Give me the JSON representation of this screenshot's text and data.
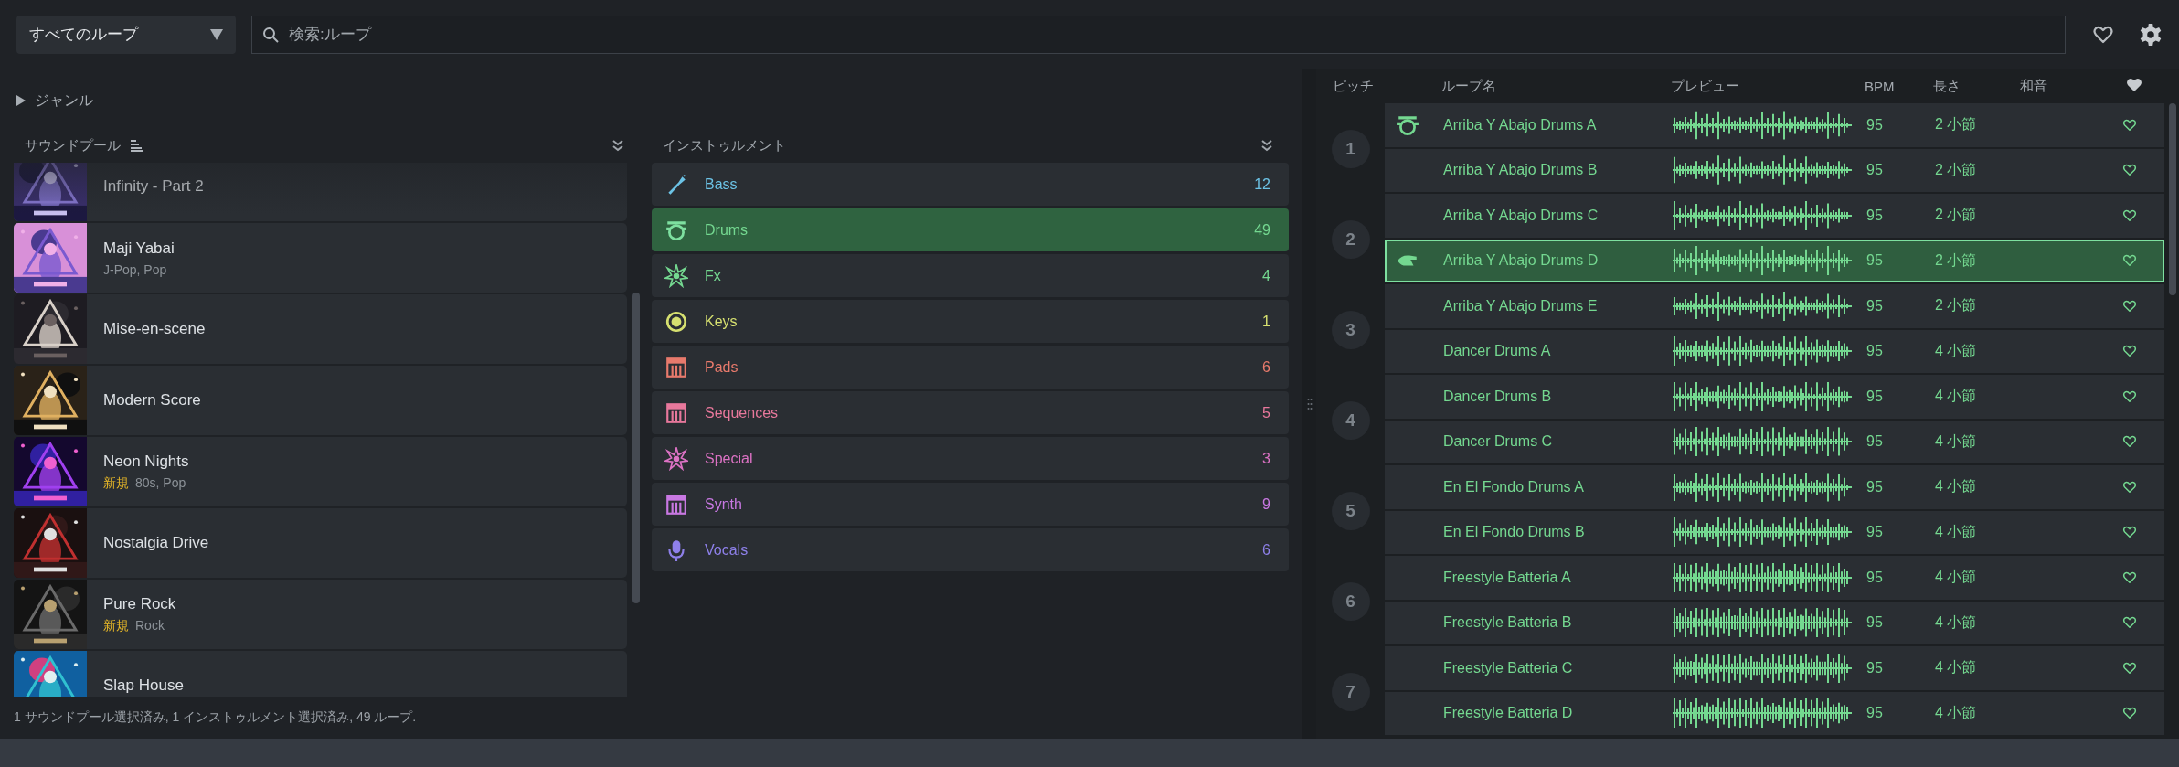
{
  "toolbar": {
    "loop_filter": "すべてのループ",
    "search": {
      "placeholder": "検索:ループ"
    }
  },
  "genre": {
    "label": "ジャンル",
    "expanded": false
  },
  "sound_pools": {
    "title": "サウンドプール",
    "items": [
      {
        "name": "Infinity - Part 2"
      },
      {
        "name": "Maji Yabai",
        "tags": "J-Pop, Pop"
      },
      {
        "name": "Mise-en-scene"
      },
      {
        "name": "Modern Score"
      },
      {
        "name": "Neon Nights",
        "badge": "新規",
        "tags": "80s, Pop"
      },
      {
        "name": "Nostalgia Drive"
      },
      {
        "name": "Pure Rock",
        "badge": "新規",
        "tags": "Rock"
      },
      {
        "name": "Slap House"
      }
    ]
  },
  "instruments": {
    "title": "インストゥルメント",
    "items": [
      {
        "name": "Bass",
        "count": "12",
        "color": "#6cc3e6",
        "kind": "bass",
        "selected": false
      },
      {
        "name": "Drums",
        "count": "49",
        "color": "#74d890",
        "kind": "drum",
        "selected": true
      },
      {
        "name": "Fx",
        "count": "4",
        "color": "#74d890",
        "kind": "burst",
        "selected": false
      },
      {
        "name": "Keys",
        "count": "1",
        "color": "#d6e070",
        "kind": "knob",
        "selected": false
      },
      {
        "name": "Pads",
        "count": "6",
        "color": "#e87a6c",
        "kind": "keyboard",
        "selected": false
      },
      {
        "name": "Sequences",
        "count": "5",
        "color": "#e8789c",
        "kind": "keyboard",
        "selected": false
      },
      {
        "name": "Special",
        "count": "3",
        "color": "#dc72c4",
        "kind": "burst",
        "selected": false
      },
      {
        "name": "Synth",
        "count": "9",
        "color": "#c878e2",
        "kind": "keyboard",
        "selected": false
      },
      {
        "name": "Vocals",
        "count": "6",
        "color": "#8e80ea",
        "kind": "mic",
        "selected": false
      }
    ]
  },
  "status": "1 サウンドプール選択済み, 1 インストゥルメント選択済み, 49 ループ.",
  "loops": {
    "columns": [
      "ピッチ",
      "ループ名",
      "プレビュー",
      "BPM",
      "長さ",
      "和音"
    ],
    "pitches": [
      "1",
      "2",
      "3",
      "4",
      "5",
      "6",
      "7"
    ],
    "rows": [
      {
        "name": "Arriba Y Abajo Drums A",
        "bpm": "95",
        "length": "2 小節",
        "kind": "drum",
        "selected": false,
        "favorite": false
      },
      {
        "name": "Arriba Y Abajo Drums B",
        "bpm": "95",
        "length": "2 小節",
        "kind": "plain",
        "selected": false,
        "favorite": false
      },
      {
        "name": "Arriba Y Abajo Drums C",
        "bpm": "95",
        "length": "2 小節",
        "kind": "plain",
        "selected": false,
        "favorite": false
      },
      {
        "name": "Arriba Y Abajo Drums D",
        "bpm": "95",
        "length": "2 小節",
        "kind": "hand",
        "selected": true,
        "favorite": false
      },
      {
        "name": "Arriba Y Abajo Drums E",
        "bpm": "95",
        "length": "2 小節",
        "kind": "plain",
        "selected": false,
        "favorite": false
      },
      {
        "name": "Dancer Drums A",
        "bpm": "95",
        "length": "4 小節",
        "kind": "plain",
        "selected": false,
        "favorite": false
      },
      {
        "name": "Dancer Drums B",
        "bpm": "95",
        "length": "4 小節",
        "kind": "plain",
        "selected": false,
        "favorite": false
      },
      {
        "name": "Dancer Drums C",
        "bpm": "95",
        "length": "4 小節",
        "kind": "plain",
        "selected": false,
        "favorite": false
      },
      {
        "name": "En El Fondo Drums A",
        "bpm": "95",
        "length": "4 小節",
        "kind": "plain",
        "selected": false,
        "favorite": false
      },
      {
        "name": "En El Fondo Drums B",
        "bpm": "95",
        "length": "4 小節",
        "kind": "plain",
        "selected": false,
        "favorite": false
      },
      {
        "name": "Freestyle Batteria A",
        "bpm": "95",
        "length": "4 小節",
        "kind": "plain",
        "selected": false,
        "favorite": false
      },
      {
        "name": "Freestyle Batteria B",
        "bpm": "95",
        "length": "4 小節",
        "kind": "plain",
        "selected": false,
        "favorite": false
      },
      {
        "name": "Freestyle Batteria C",
        "bpm": "95",
        "length": "4 小節",
        "kind": "plain",
        "selected": false,
        "favorite": false
      },
      {
        "name": "Freestyle Batteria D",
        "bpm": "95",
        "length": "4 小節",
        "kind": "plain",
        "selected": false,
        "favorite": false
      }
    ]
  }
}
